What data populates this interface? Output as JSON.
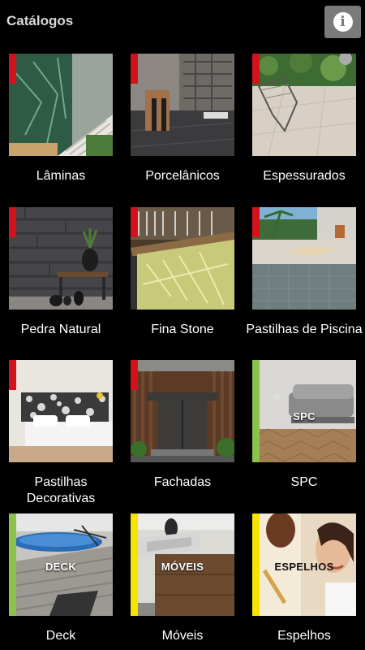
{
  "header": {
    "title": "Catálogos",
    "info_icon": "info-icon"
  },
  "colors": {
    "red_accent": "#d3121b",
    "green_accent": "#8bc34a",
    "yellow_accent": "#f5e400",
    "info_bg": "#7a7a7a"
  },
  "tiles": [
    {
      "label": "Lâminas"
    },
    {
      "label": "Porcelânicos"
    },
    {
      "label": "Espessurados"
    },
    {
      "label": "Pedra Natural"
    },
    {
      "label": "Fina Stone"
    },
    {
      "label": "Pastilhas de Piscina"
    },
    {
      "label": "Pastilhas Decorativas"
    },
    {
      "label": "Fachadas"
    },
    {
      "label": "SPC",
      "overlay": "SPC"
    },
    {
      "label": "Deck",
      "overlay": "DECK"
    },
    {
      "label": "Móveis",
      "overlay": "MÓVEIS"
    },
    {
      "label": "Espelhos",
      "overlay": "ESPELHOS"
    }
  ]
}
